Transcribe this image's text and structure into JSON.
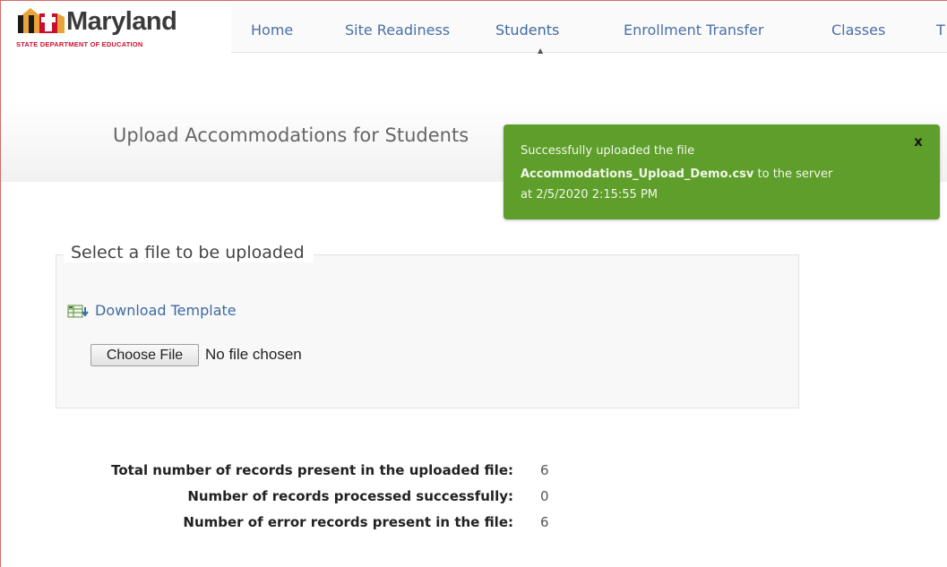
{
  "app": {
    "logo": {
      "name": "Maryland",
      "subtitle": "STATE DEPARTMENT OF EDUCATION"
    }
  },
  "nav": {
    "items": [
      {
        "label": "Home"
      },
      {
        "label": "Site Readiness"
      },
      {
        "label": "Students",
        "active": true
      },
      {
        "label": "Enrollment Transfer"
      },
      {
        "label": "Classes"
      },
      {
        "label": "T"
      }
    ],
    "active_marker": "▲"
  },
  "page": {
    "title": "Upload Accommodations for Students"
  },
  "toast": {
    "line1": "Successfully uploaded the file",
    "filename": "Accommodations_Upload_Demo.csv",
    "line2_suffix": " to the server",
    "line3": "at 2/5/2020 2:15:55 PM",
    "close_label": "x",
    "color": "#5e9e2a"
  },
  "upload": {
    "legend": "Select a file to be uploaded",
    "download_template": "Download Template",
    "choose_file_button": "Choose File",
    "file_status": "No file chosen"
  },
  "results": {
    "rows": [
      {
        "label": "Total number of records present in the uploaded file:",
        "value": "6"
      },
      {
        "label": "Number of records processed successfully:",
        "value": "0"
      },
      {
        "label": "Number of error records present in the file:",
        "value": "6"
      }
    ]
  },
  "icons": {
    "logo": "maryland-flag-icon",
    "download": "spreadsheet-download-icon",
    "close": "close-icon"
  }
}
